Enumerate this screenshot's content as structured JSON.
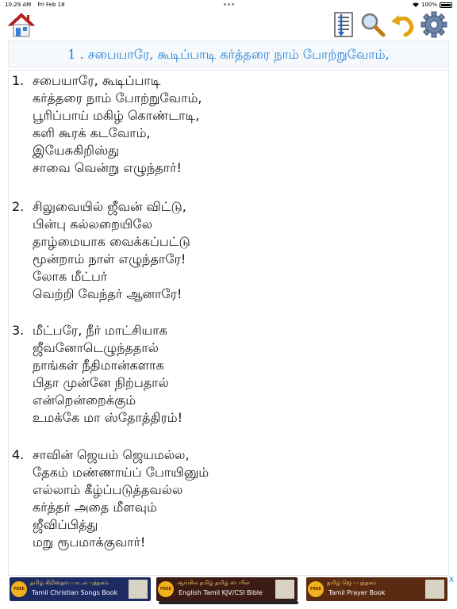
{
  "status": {
    "time": "10:29 AM",
    "date": "Fri Feb 18",
    "battery": "100%"
  },
  "toolbar": {
    "home": "home-icon",
    "list": "list-icon",
    "search": "search-icon",
    "undo": "undo-icon",
    "settings": "gear-icon"
  },
  "title": "1 . சபையாரே, கூடிப்பாடி கர்த்தரை நாம் போற்றுவோம்,",
  "verses": [
    {
      "num": "1.",
      "lines": [
        "சபையாரே, கூடிப்பாடி",
        "கர்த்தரை நாம் போற்றுவோம்,",
        "பூரிப்பாய் மகிழ் கொண்டாடி,",
        "களி கூரக் கடவோம்,",
        "இயேசுகிறிஸ்து",
        "சாவை வென்று எழுந்தார்!"
      ]
    },
    {
      "num": "2.",
      "lines": [
        "சிலுவையில் ஜீவன் விட்டு,",
        "பின்பு கல்லறையிலே",
        "தாழ்மையாக வைக்கப்பட்டு",
        "மூன்றாம் நாள் எழுந்தாரே!",
        "லோக மீட்பர்",
        "வெற்றி வேந்தர் ஆனாரே!"
      ]
    },
    {
      "num": "3.",
      "lines": [
        "மீட்பரே, நீர் மாட்சியாக",
        "ஜீவனோடெழுந்ததால்",
        "நாங்கள் நீதிமான்களாக",
        "பிதா முன்னே நிற்பதால்",
        "என்றென்றைக்கும்",
        "உமக்கே மா ஸ்தோத்திரம்!"
      ]
    },
    {
      "num": "4.",
      "lines": [
        "சாவின் ஜெயம் ஜெயமல்ல,",
        "தேகம் மண்ணாய்ப் போயினும்",
        "எல்லாம் கீழ்ப்படுத்தவல்ல",
        "கர்த்தர் அதை மீளவும்",
        "ஜீவிப்பித்து",
        "மறு ரூபமாக்குவார்!"
      ]
    }
  ],
  "ads": [
    {
      "badge": "FREE",
      "line1": "தமிழ் கிறிஸ்தவ பாடல் புத்தகம்",
      "line2": "Tamil Christian Songs Book"
    },
    {
      "badge": "FREE",
      "line1": "ஆங்கில தமிழ் தமிழ் பைபிள்",
      "line2": "English Tamil KJV/CSI Bible"
    },
    {
      "badge": "FREE",
      "line1": "தமிழ் ஜெப புத்தகம்",
      "line2": "Tamil Prayer Book"
    }
  ],
  "ad_close": "X"
}
